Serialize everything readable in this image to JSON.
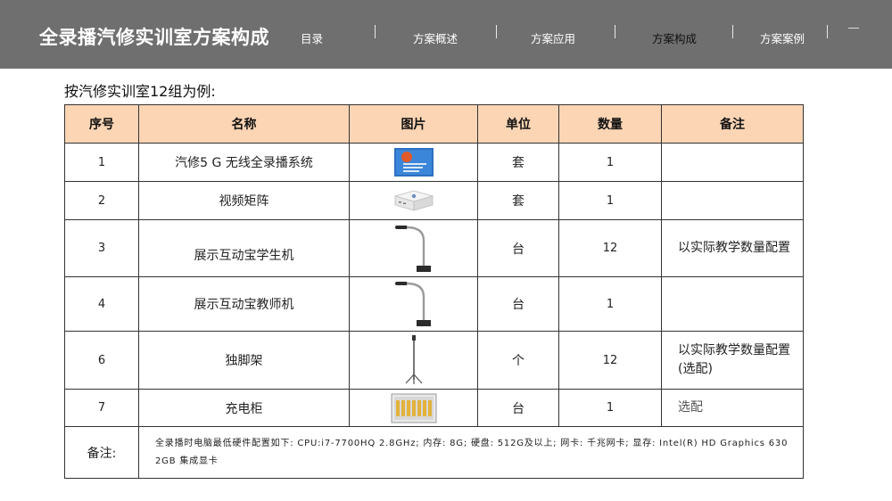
{
  "header": {
    "title": "全录播汽修实训室方案构成",
    "nav": [
      {
        "label": "目录"
      },
      {
        "label": "方案概述"
      },
      {
        "label": "方案应用"
      },
      {
        "label": "方案构成"
      },
      {
        "label": "方案案例"
      }
    ],
    "active_nav": "方案构成"
  },
  "subtitle": "按汽修实训室12组为例:",
  "table": {
    "headers": [
      "序号",
      "名称",
      "图片",
      "单位",
      "数量",
      "备注"
    ],
    "rows": [
      {
        "no": "1",
        "name": "汽修5 G 无线全录播系统",
        "image": "software-box-image",
        "unit": "套",
        "qty": "1",
        "remark": ""
      },
      {
        "no": "2",
        "name": "视频矩阵",
        "image": "white-box-device-image",
        "unit": "套",
        "qty": "1",
        "remark": ""
      },
      {
        "no": "3",
        "name": "展示互动宝学生机",
        "image": "gooseneck-camera-image",
        "unit": "台",
        "qty": "12",
        "remark": "以实际教学数量配置"
      },
      {
        "no": "4",
        "name": "展示互动宝教师机",
        "image": "gooseneck-camera-image",
        "unit": "台",
        "qty": "1",
        "remark": ""
      },
      {
        "no": "6",
        "name": "独脚架",
        "image": "monopod-image",
        "unit": "个",
        "qty": "12",
        "remark": "以实际教学数量配置 (选配)"
      },
      {
        "no": "7",
        "name": "充电柜",
        "image": "charging-cabinet-image",
        "unit": "台",
        "qty": "1",
        "remark": "选配"
      }
    ],
    "footer": {
      "label": "备注:",
      "text": "全录播时电脑最低硬件配置如下: CPU:i7-7700HQ 2.8GHz; 内存: 8G; 硬盘: 512G及以上; 网卡: 千兆网卡; 显存: Intel(R) HD Graphics 630 2GB 集成显卡"
    }
  },
  "colors": {
    "header_bg": "#6f6f6f",
    "table_header_bg": "#fcd5b5",
    "active_nav_text": "#111111"
  }
}
